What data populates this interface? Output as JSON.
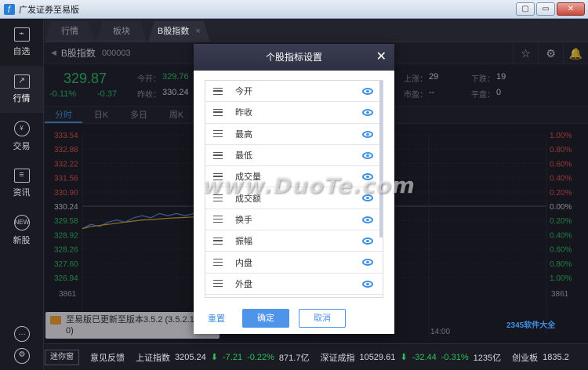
{
  "window": {
    "title": "广发证券至易版",
    "app_icon": "ƒ",
    "controls": [
      "▢",
      "▭",
      "✕"
    ]
  },
  "sidebar": {
    "items": [
      {
        "label": "自选",
        "icon": "chart-icon"
      },
      {
        "label": "行情",
        "icon": "trend-icon"
      },
      {
        "label": "交易",
        "icon": "yen-icon",
        "glyph": "¥"
      },
      {
        "label": "资讯",
        "icon": "document-icon",
        "glyph": "≡"
      },
      {
        "label": "新股",
        "icon": "new-icon",
        "glyph": "NEW"
      }
    ],
    "bottom": [
      {
        "icon": "chat-icon",
        "glyph": "…"
      },
      {
        "icon": "settings-icon",
        "glyph": "⚙"
      }
    ]
  },
  "tabs": [
    {
      "label": "行情"
    },
    {
      "label": "板块"
    },
    {
      "label": "B股指数",
      "close": "×"
    }
  ],
  "stock": {
    "name": "B股指数",
    "code": "000003",
    "arrow_left": "◀",
    "arrow_right": "▶"
  },
  "toolbar_icons": [
    {
      "name": "star-icon",
      "glyph": "☆"
    },
    {
      "name": "gear-icon",
      "glyph": "⚙"
    },
    {
      "name": "bell-icon",
      "glyph": "🔔"
    }
  ],
  "quote": {
    "price": "329.87",
    "pct": "-0.11%",
    "change": "-0.37",
    "open_label": "今开：",
    "open_value": "329.76",
    "prev_label": "昨收：",
    "prev_value": "330.24",
    "up_label": "上涨：",
    "up_value": "29",
    "down_label": "下跌：",
    "down_value": "19",
    "pe_label": "市盈：",
    "pe_value": "--",
    "flat_label": "平盘：",
    "flat_value": "0"
  },
  "periods": [
    "分时",
    "日K",
    "多日",
    "周K"
  ],
  "chart_data": {
    "type": "line",
    "y_left": [
      "333.54",
      "332.88",
      "332.22",
      "331.56",
      "330.90",
      "330.24",
      "329.58",
      "328.92",
      "328.26",
      "327.60",
      "326.94"
    ],
    "y_right": [
      "1.00%",
      "0.80%",
      "0.60%",
      "0.40%",
      "0.20%",
      "0.00%",
      "0.20%",
      "0.40%",
      "0.60%",
      "0.80%",
      "1.00%"
    ],
    "volume_left": "3861",
    "volume_right": "3861",
    "x_label": "14:00",
    "base": 330.24,
    "series": [
      {
        "values": [
          329.2,
          329.4,
          329.3,
          329.5,
          329.6,
          329.5,
          329.7,
          329.8,
          329.7,
          329.9,
          329.8,
          329.9,
          329.8,
          329.9
        ]
      },
      {
        "values": [
          329.2,
          329.3,
          329.35,
          329.4,
          329.45,
          329.5,
          329.55,
          329.6,
          329.62,
          329.65,
          329.68,
          329.7,
          329.72,
          329.74
        ]
      }
    ]
  },
  "notice": {
    "text": "至易版已更新至版本3.5.2 (3.5.2.11",
    "text2": "0)"
  },
  "modal": {
    "title": "个股指标设置",
    "close": "✕",
    "items": [
      "今开",
      "昨收",
      "最高",
      "最低",
      "成交量",
      "成交额",
      "换手",
      "振幅",
      "内盘",
      "外盘"
    ],
    "reset": "重置",
    "ok": "确定",
    "cancel": "取消"
  },
  "infobar": {
    "mini_button": "迷你窗",
    "feedback": "意见反馈",
    "index1_name": "上证指数",
    "index1_value": "3205.24",
    "index1_change": "-7.21",
    "index1_pct": "-0.22%",
    "index1_amount": "871.7亿",
    "index2_name": "深证成指",
    "index2_value": "10529.61",
    "index2_change": "-32.44",
    "index2_pct": "-0.31%",
    "index2_amount": "1235亿",
    "index3_name": "创业板",
    "index3_value": "1835.2",
    "down_arrow": "⬇"
  },
  "watermark": {
    "text": "www.DuoTe.com",
    "corner": "2345软件大全"
  }
}
